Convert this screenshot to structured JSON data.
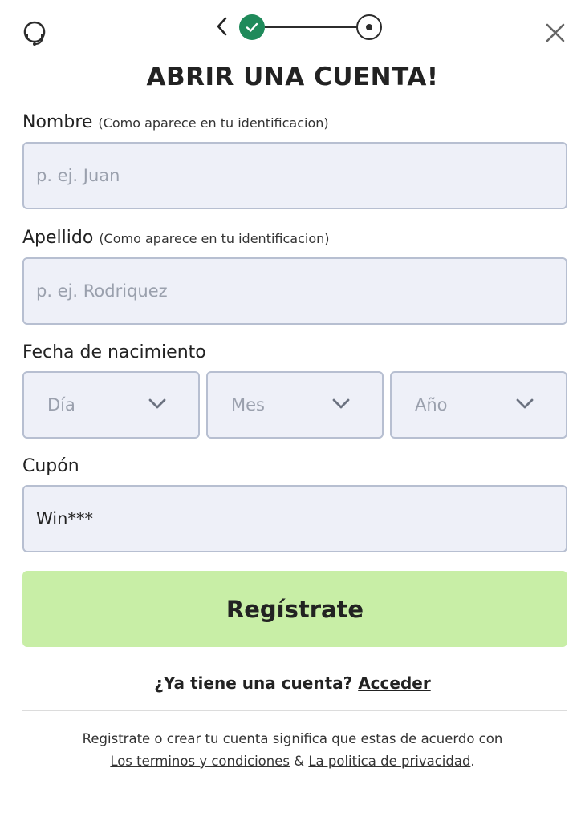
{
  "header": {
    "support_icon": "headset-support-icon",
    "back_icon": "chevron-left-icon",
    "close_icon": "close-icon",
    "steps": [
      "completed",
      "current"
    ],
    "step_color": "#1f8a5a"
  },
  "title": "ABRIR UNA CUENTA!",
  "form": {
    "first_name": {
      "label": "Nombre",
      "hint": "(Como aparece en tu identificacion)",
      "placeholder": "p. ej. Juan",
      "value": ""
    },
    "last_name": {
      "label": "Apellido",
      "hint": "(Como aparece en tu identificacion)",
      "placeholder": "p. ej. Rodriquez",
      "value": ""
    },
    "birthdate": {
      "label": "Fecha de nacimiento",
      "day": "Día",
      "month": "Mes",
      "year": "Año"
    },
    "coupon": {
      "label": "Cupón",
      "value": "Win***"
    },
    "submit_label": "Regístrate",
    "submit_color": "#c8eea6"
  },
  "login": {
    "prompt": "¿Ya tiene una cuenta?",
    "link": "Acceder"
  },
  "legal": {
    "line1": "Registrate o crear tu cuenta significa que estas de acuerdo con",
    "terms": "Los terminos y condiciones",
    "amp": "&",
    "privacy": "La politica de privacidad",
    "end": "."
  }
}
